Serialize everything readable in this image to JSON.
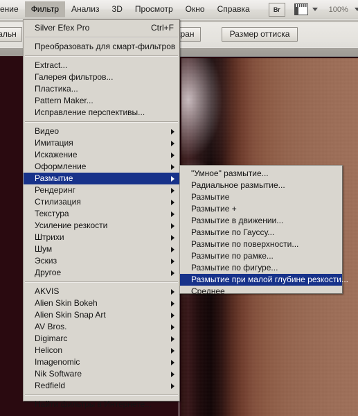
{
  "app": {
    "zoom_level": "100%",
    "accent_highlight": "#17328a",
    "menu_face": "#d9d6cf",
    "canvas_photo_tone": "#92624c"
  },
  "menubar": {
    "items": [
      {
        "label": "ение",
        "clipped": true,
        "active": false
      },
      {
        "label": "Фильтр",
        "clipped": false,
        "active": true
      },
      {
        "label": "Анализ",
        "clipped": false,
        "active": false
      },
      {
        "label": "3D",
        "clipped": false,
        "active": false
      },
      {
        "label": "Просмотр",
        "clipped": false,
        "active": false
      },
      {
        "label": "Окно",
        "clipped": false,
        "active": false
      },
      {
        "label": "Справка",
        "clipped": false,
        "active": false
      }
    ],
    "bridge_button_label": "Br",
    "screen_mode_icon": "screen-mode-icon",
    "zoom_label": "100%"
  },
  "optionsbar": {
    "buttons": [
      {
        "label": "ь экран",
        "clipped": true
      },
      {
        "label": "Размер оттиска",
        "clipped": false
      }
    ],
    "left_clipped_label": "ктуальн"
  },
  "filter_menu": {
    "title": "Фильтр",
    "groups": [
      {
        "items": [
          {
            "label": "Silver Efex Pro",
            "accel": "Ctrl+F",
            "submenu": false,
            "selected": false
          }
        ]
      },
      {
        "items": [
          {
            "label": "Преобразовать для смарт-фильтров",
            "accel": "",
            "submenu": false,
            "selected": false
          }
        ]
      },
      {
        "items": [
          {
            "label": "Extract...",
            "accel": "",
            "submenu": false,
            "selected": false
          },
          {
            "label": "Галерея фильтров...",
            "accel": "",
            "submenu": false,
            "selected": false
          },
          {
            "label": "Пластика...",
            "accel": "",
            "submenu": false,
            "selected": false
          },
          {
            "label": "Pattern Maker...",
            "accel": "",
            "submenu": false,
            "selected": false
          },
          {
            "label": "Исправление перспективы...",
            "accel": "",
            "submenu": false,
            "selected": false
          }
        ]
      },
      {
        "items": [
          {
            "label": "Видео",
            "accel": "",
            "submenu": true,
            "selected": false
          },
          {
            "label": "Имитация",
            "accel": "",
            "submenu": true,
            "selected": false
          },
          {
            "label": "Искажение",
            "accel": "",
            "submenu": true,
            "selected": false
          },
          {
            "label": "Оформление",
            "accel": "",
            "submenu": true,
            "selected": false
          },
          {
            "label": "Размытие",
            "accel": "",
            "submenu": true,
            "selected": true
          },
          {
            "label": "Рендеринг",
            "accel": "",
            "submenu": true,
            "selected": false
          },
          {
            "label": "Стилизация",
            "accel": "",
            "submenu": true,
            "selected": false
          },
          {
            "label": "Текстура",
            "accel": "",
            "submenu": true,
            "selected": false
          },
          {
            "label": "Усиление резкости",
            "accel": "",
            "submenu": true,
            "selected": false
          },
          {
            "label": "Штрихи",
            "accel": "",
            "submenu": true,
            "selected": false
          },
          {
            "label": "Шум",
            "accel": "",
            "submenu": true,
            "selected": false
          },
          {
            "label": "Эскиз",
            "accel": "",
            "submenu": true,
            "selected": false
          },
          {
            "label": "Другое",
            "accel": "",
            "submenu": true,
            "selected": false
          }
        ]
      },
      {
        "items": [
          {
            "label": "AKVIS",
            "accel": "",
            "submenu": true,
            "selected": false
          },
          {
            "label": "Alien Skin Bokeh",
            "accel": "",
            "submenu": true,
            "selected": false
          },
          {
            "label": "Alien Skin Snap Art",
            "accel": "",
            "submenu": true,
            "selected": false
          },
          {
            "label": "AV Bros.",
            "accel": "",
            "submenu": true,
            "selected": false
          },
          {
            "label": "Digimarc",
            "accel": "",
            "submenu": true,
            "selected": false
          },
          {
            "label": "Helicon",
            "accel": "",
            "submenu": true,
            "selected": false
          },
          {
            "label": "Imagenomic",
            "accel": "",
            "submenu": true,
            "selected": false
          },
          {
            "label": "Nik Software",
            "accel": "",
            "submenu": true,
            "selected": false
          },
          {
            "label": "Redfield",
            "accel": "",
            "submenu": true,
            "selected": false
          }
        ]
      },
      {
        "items": [
          {
            "label": "Найти фильтры в Интернете...",
            "accel": "",
            "submenu": false,
            "selected": false
          }
        ]
      }
    ]
  },
  "blur_submenu": {
    "title": "Размытие",
    "items": [
      {
        "label": "\"Умное\" размытие...",
        "selected": false
      },
      {
        "label": "Радиальное размытие...",
        "selected": false
      },
      {
        "label": "Размытие",
        "selected": false
      },
      {
        "label": "Размытие +",
        "selected": false
      },
      {
        "label": "Размытие в движении...",
        "selected": false
      },
      {
        "label": "Размытие по Гауссу...",
        "selected": false
      },
      {
        "label": "Размытие по поверхности...",
        "selected": false
      },
      {
        "label": "Размытие по рамке...",
        "selected": false
      },
      {
        "label": "Размытие по фигуре...",
        "selected": false
      },
      {
        "label": "Размытие при малой глубине резкости...",
        "selected": true
      },
      {
        "label": "Среднее",
        "selected": false
      }
    ]
  }
}
